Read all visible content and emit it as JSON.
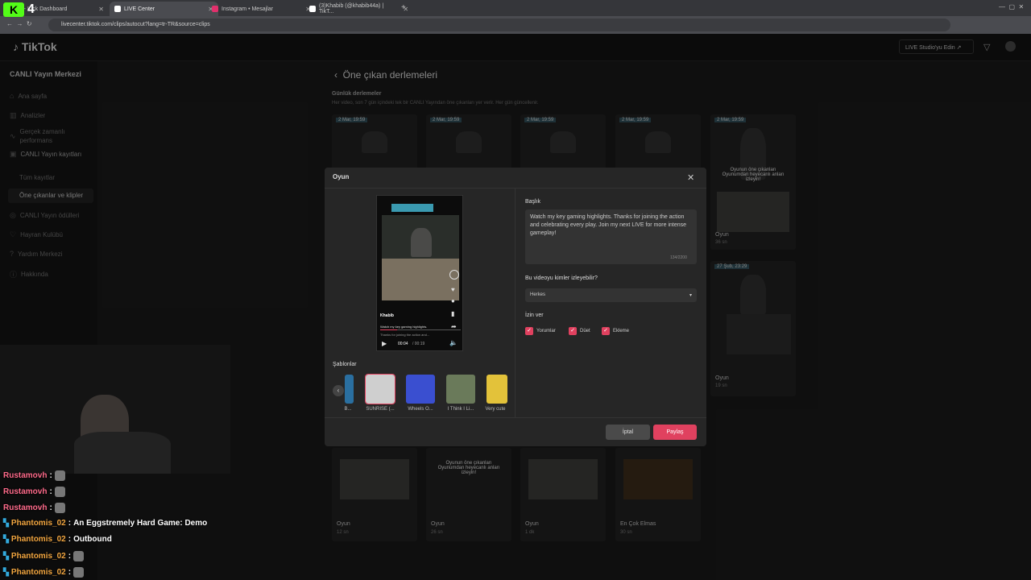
{
  "browser": {
    "tabs": [
      {
        "title": "am - Kick Dashboard",
        "active": false,
        "color": "#53fc18"
      },
      {
        "title": "LIVE Center",
        "active": true,
        "color": "#ffffff"
      },
      {
        "title": "Instagram • Mesajlar",
        "active": false,
        "color": "#e1306c"
      },
      {
        "title": "(3)Khabib (@khabib44a) | TikT...",
        "active": false,
        "color": "#ffffff"
      }
    ],
    "url": "livecenter.tiktok.com/clips/autocut?lang=tr-TR&source=clips"
  },
  "overlay_badge": {
    "k": "K",
    "count": "4"
  },
  "header": {
    "logo": "TikTok",
    "studio_button": "LIVE Studio'yu Edin ↗"
  },
  "sidebar": {
    "title": "CANLI Yayın Merkezi",
    "items": [
      {
        "label": "Ana sayfa",
        "icon": "home-icon"
      },
      {
        "label": "Analizler",
        "icon": "chart-icon"
      },
      {
        "label": "Gerçek zamanlı performans",
        "icon": "pulse-icon"
      },
      {
        "label": "CANLI Yayın kayıtları",
        "icon": "video-icon"
      },
      {
        "label": "Tüm kayıtlar",
        "icon": ""
      },
      {
        "label": "Öne çıkanlar ve klipler",
        "icon": ""
      },
      {
        "label": "CANLI Yayın ödülleri",
        "icon": "award-icon"
      },
      {
        "label": "Hayran Kulübü",
        "icon": "heart-icon"
      },
      {
        "label": "Yardım Merkezi",
        "icon": "help-icon"
      },
      {
        "label": "Hakkında",
        "icon": "info-icon"
      }
    ]
  },
  "main": {
    "title": "Öne çıkan derlemeleri",
    "section_title": "Günlük derlemeler",
    "section_desc": "Her video, son 7 gün içindeki tek bir CANLI Yayından öne çıkanları yer verir. Her gün güncellenir.",
    "top_dates": [
      "2 Mar, 19:59",
      "2 Mar, 19:59",
      "2 Mar, 19:59",
      "2 Mar, 19:59",
      "2 Mar, 19:59"
    ],
    "right_cards": [
      {
        "caption": "Oyunun öne çıkanları Oyunumdan heyecanlı anları izleyin!",
        "label": "Oyun",
        "dur": "36 sn"
      },
      {
        "date": "27 Şub, 23:29",
        "label": "Oyun",
        "dur": "19 sn"
      }
    ],
    "bottom_cards": [
      {
        "label": "Oyun",
        "dur": "12 sn",
        "caption": ""
      },
      {
        "label": "Oyun",
        "dur": "26 sn",
        "caption": "Oyunun öne çıkanları Oyunumdan heyecanlı anları izleyin!"
      },
      {
        "label": "Oyun",
        "dur": "1 dk",
        "caption": ""
      },
      {
        "label": "En Çok Elmas",
        "dur": "30 sn",
        "caption": ""
      }
    ]
  },
  "modal": {
    "title": "Oyun",
    "preview": {
      "user": "Khabib",
      "caption1": "Watch my key gaming highlights.",
      "caption2": "Thanks for joining the action and...",
      "time": "00:04",
      "total": "/ 00:19"
    },
    "caption_label": "Başlık",
    "caption_text": "Watch my key gaming highlights. Thanks for joining the action and celebrating every play. Join my next LIVE for more intense gameplay!",
    "counter": "134/2200",
    "visibility_label": "Bu videoyu kimler izleyebilir?",
    "visibility_value": "Herkes",
    "permissions_label": "İzin ver",
    "permissions": [
      "Yorumlar",
      "Düet",
      "Ekleme"
    ],
    "templates_label": "Şablonlar",
    "templates": [
      {
        "name": "B...",
        "color": "#2a6fa0"
      },
      {
        "name": "SUNRISE (...",
        "color": "#cfcfcf"
      },
      {
        "name": "Wheels O...",
        "color": "#3a4fd0"
      },
      {
        "name": "I Think I Li...",
        "color": "#6a7a5a"
      },
      {
        "name": "Very cute",
        "color": "#e3c23a"
      }
    ],
    "cancel": "İptal",
    "share": "Paylaş"
  },
  "chat": [
    {
      "user": "Rustamovh",
      "msg": "",
      "emote": true,
      "ucolor": "n"
    },
    {
      "user": "Rustamovh",
      "msg": "",
      "emote": true,
      "ucolor": "n"
    },
    {
      "user": "Rustamovh",
      "msg": "",
      "emote": true,
      "ucolor": "n"
    },
    {
      "user": "Phantomis_02",
      "msg": "An Eggstremely Hard Game: Demo",
      "emote": false,
      "ucolor": "n2"
    },
    {
      "user": "Phantomis_02",
      "msg": "Outbound",
      "emote": false,
      "ucolor": "n2"
    },
    {
      "user": "Phantomis_02",
      "msg": "",
      "emote": true,
      "ucolor": "n2"
    },
    {
      "user": "Phantomis_02",
      "msg": "",
      "emote": true,
      "ucolor": "n2"
    }
  ]
}
